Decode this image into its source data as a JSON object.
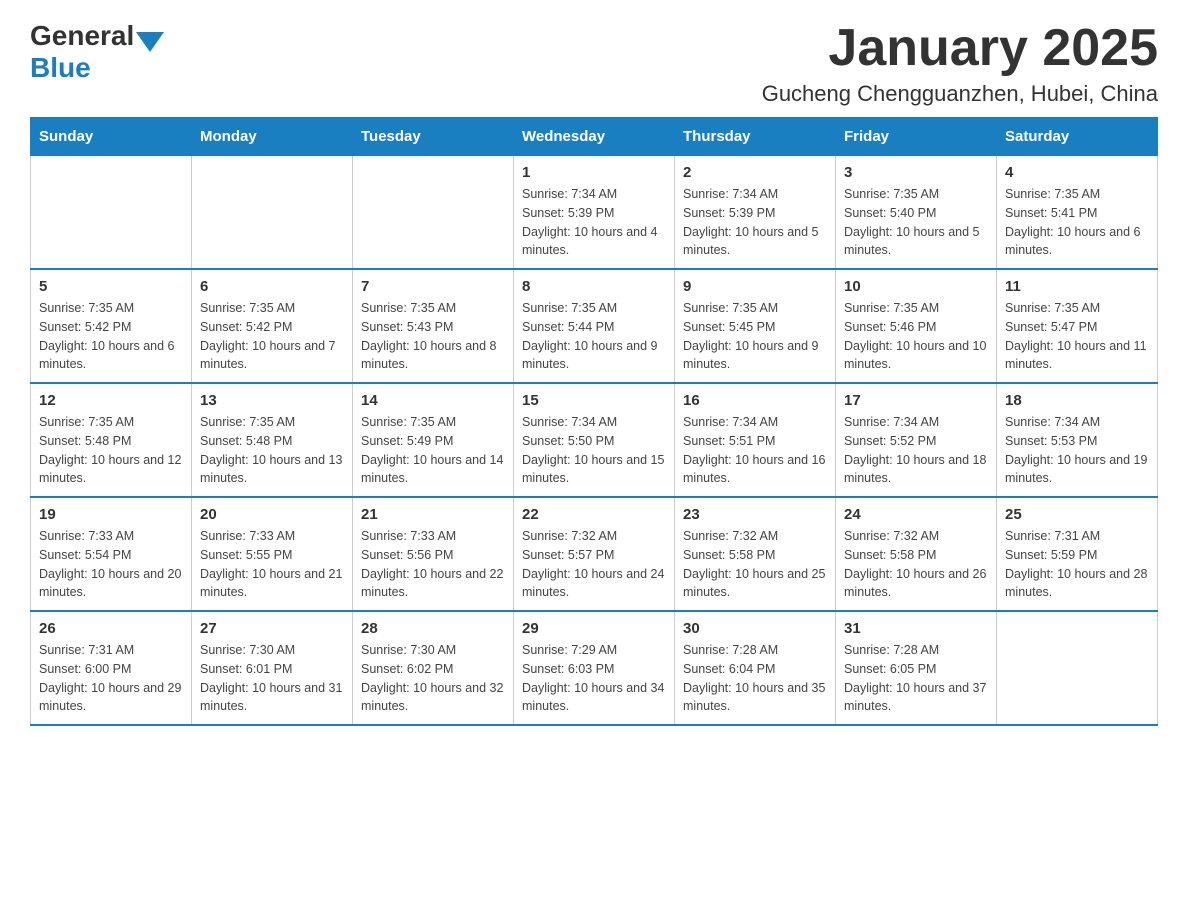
{
  "header": {
    "logo": {
      "text_general": "General",
      "text_blue": "Blue"
    },
    "title": "January 2025",
    "subtitle": "Gucheng Chengguanzhen, Hubei, China"
  },
  "weekdays": [
    "Sunday",
    "Monday",
    "Tuesday",
    "Wednesday",
    "Thursday",
    "Friday",
    "Saturday"
  ],
  "weeks": [
    [
      {
        "day": "",
        "info": ""
      },
      {
        "day": "",
        "info": ""
      },
      {
        "day": "",
        "info": ""
      },
      {
        "day": "1",
        "info": "Sunrise: 7:34 AM\nSunset: 5:39 PM\nDaylight: 10 hours and 4 minutes."
      },
      {
        "day": "2",
        "info": "Sunrise: 7:34 AM\nSunset: 5:39 PM\nDaylight: 10 hours and 5 minutes."
      },
      {
        "day": "3",
        "info": "Sunrise: 7:35 AM\nSunset: 5:40 PM\nDaylight: 10 hours and 5 minutes."
      },
      {
        "day": "4",
        "info": "Sunrise: 7:35 AM\nSunset: 5:41 PM\nDaylight: 10 hours and 6 minutes."
      }
    ],
    [
      {
        "day": "5",
        "info": "Sunrise: 7:35 AM\nSunset: 5:42 PM\nDaylight: 10 hours and 6 minutes."
      },
      {
        "day": "6",
        "info": "Sunrise: 7:35 AM\nSunset: 5:42 PM\nDaylight: 10 hours and 7 minutes."
      },
      {
        "day": "7",
        "info": "Sunrise: 7:35 AM\nSunset: 5:43 PM\nDaylight: 10 hours and 8 minutes."
      },
      {
        "day": "8",
        "info": "Sunrise: 7:35 AM\nSunset: 5:44 PM\nDaylight: 10 hours and 9 minutes."
      },
      {
        "day": "9",
        "info": "Sunrise: 7:35 AM\nSunset: 5:45 PM\nDaylight: 10 hours and 9 minutes."
      },
      {
        "day": "10",
        "info": "Sunrise: 7:35 AM\nSunset: 5:46 PM\nDaylight: 10 hours and 10 minutes."
      },
      {
        "day": "11",
        "info": "Sunrise: 7:35 AM\nSunset: 5:47 PM\nDaylight: 10 hours and 11 minutes."
      }
    ],
    [
      {
        "day": "12",
        "info": "Sunrise: 7:35 AM\nSunset: 5:48 PM\nDaylight: 10 hours and 12 minutes."
      },
      {
        "day": "13",
        "info": "Sunrise: 7:35 AM\nSunset: 5:48 PM\nDaylight: 10 hours and 13 minutes."
      },
      {
        "day": "14",
        "info": "Sunrise: 7:35 AM\nSunset: 5:49 PM\nDaylight: 10 hours and 14 minutes."
      },
      {
        "day": "15",
        "info": "Sunrise: 7:34 AM\nSunset: 5:50 PM\nDaylight: 10 hours and 15 minutes."
      },
      {
        "day": "16",
        "info": "Sunrise: 7:34 AM\nSunset: 5:51 PM\nDaylight: 10 hours and 16 minutes."
      },
      {
        "day": "17",
        "info": "Sunrise: 7:34 AM\nSunset: 5:52 PM\nDaylight: 10 hours and 18 minutes."
      },
      {
        "day": "18",
        "info": "Sunrise: 7:34 AM\nSunset: 5:53 PM\nDaylight: 10 hours and 19 minutes."
      }
    ],
    [
      {
        "day": "19",
        "info": "Sunrise: 7:33 AM\nSunset: 5:54 PM\nDaylight: 10 hours and 20 minutes."
      },
      {
        "day": "20",
        "info": "Sunrise: 7:33 AM\nSunset: 5:55 PM\nDaylight: 10 hours and 21 minutes."
      },
      {
        "day": "21",
        "info": "Sunrise: 7:33 AM\nSunset: 5:56 PM\nDaylight: 10 hours and 22 minutes."
      },
      {
        "day": "22",
        "info": "Sunrise: 7:32 AM\nSunset: 5:57 PM\nDaylight: 10 hours and 24 minutes."
      },
      {
        "day": "23",
        "info": "Sunrise: 7:32 AM\nSunset: 5:58 PM\nDaylight: 10 hours and 25 minutes."
      },
      {
        "day": "24",
        "info": "Sunrise: 7:32 AM\nSunset: 5:58 PM\nDaylight: 10 hours and 26 minutes."
      },
      {
        "day": "25",
        "info": "Sunrise: 7:31 AM\nSunset: 5:59 PM\nDaylight: 10 hours and 28 minutes."
      }
    ],
    [
      {
        "day": "26",
        "info": "Sunrise: 7:31 AM\nSunset: 6:00 PM\nDaylight: 10 hours and 29 minutes."
      },
      {
        "day": "27",
        "info": "Sunrise: 7:30 AM\nSunset: 6:01 PM\nDaylight: 10 hours and 31 minutes."
      },
      {
        "day": "28",
        "info": "Sunrise: 7:30 AM\nSunset: 6:02 PM\nDaylight: 10 hours and 32 minutes."
      },
      {
        "day": "29",
        "info": "Sunrise: 7:29 AM\nSunset: 6:03 PM\nDaylight: 10 hours and 34 minutes."
      },
      {
        "day": "30",
        "info": "Sunrise: 7:28 AM\nSunset: 6:04 PM\nDaylight: 10 hours and 35 minutes."
      },
      {
        "day": "31",
        "info": "Sunrise: 7:28 AM\nSunset: 6:05 PM\nDaylight: 10 hours and 37 minutes."
      },
      {
        "day": "",
        "info": ""
      }
    ]
  ]
}
